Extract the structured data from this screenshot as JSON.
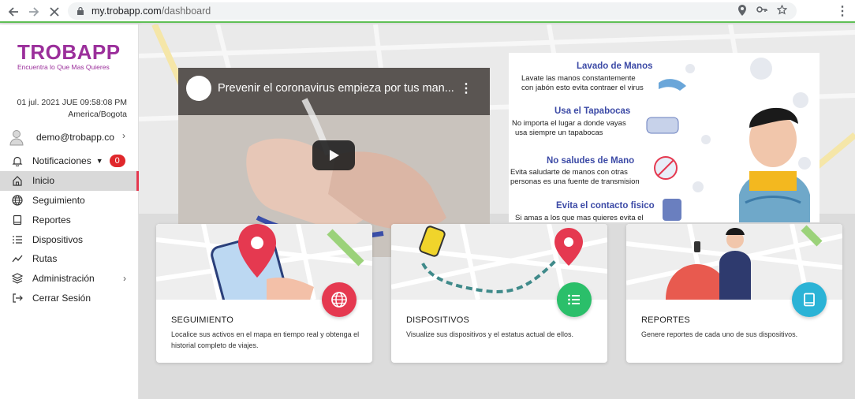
{
  "browser": {
    "url_host": "my.trobapp.com",
    "url_path": "/dashboard"
  },
  "sidebar": {
    "logo_text": "TROBAPP",
    "logo_subtitle": "Encuentra lo Que Mas Quieres",
    "datetime": "01 jul. 2021 JUE 09:58:08 PM",
    "timezone": "America/Bogota",
    "user_email": "demo@trobapp.co",
    "items": [
      {
        "label": "Notificaciones",
        "icon": "bell-icon",
        "badge": "0"
      },
      {
        "label": "Inicio",
        "icon": "home-icon",
        "active": true
      },
      {
        "label": "Seguimiento",
        "icon": "globe-icon"
      },
      {
        "label": "Reportes",
        "icon": "book-icon"
      },
      {
        "label": "Dispositivos",
        "icon": "list-icon"
      },
      {
        "label": "Rutas",
        "icon": "route-icon"
      },
      {
        "label": "Administración",
        "icon": "layers-icon"
      },
      {
        "label": "Cerrar Sesión",
        "icon": "logout-icon"
      }
    ]
  },
  "video": {
    "title": "Prevenir el coronavirus empieza por tus man..."
  },
  "info": {
    "items": [
      {
        "title": "Lavado de Manos",
        "text": [
          "Lavate las manos constantemente",
          "con jabón esto evita contraer el virus"
        ]
      },
      {
        "title": "Usa el Tapabocas",
        "text": [
          "No importa el lugar a donde vayas",
          "usa siempre un tapabocas"
        ]
      },
      {
        "title": "No saludes de Mano",
        "text": [
          "Evita saludarte de manos con otras",
          "personas es una fuente de transmision"
        ]
      },
      {
        "title": "Evita el contacto fisico",
        "text": [
          "Si amas a los que mas quieres evita el"
        ]
      }
    ]
  },
  "cards": [
    {
      "title": "SEGUIMIENTO",
      "desc": "Localice sus activos en el mapa en tiempo real y obtenga el historial completo de viajes.",
      "color": "#e53950",
      "icon": "globe-icon"
    },
    {
      "title": "DISPOSITIVOS",
      "desc": "Visualize sus dispositivos y el estatus actual de ellos.",
      "color": "#2bbf6a",
      "icon": "list-icon"
    },
    {
      "title": "REPORTES",
      "desc": "Genere reportes de cada uno de sus dispositivos.",
      "color": "#2bb3d6",
      "icon": "book-icon"
    }
  ]
}
